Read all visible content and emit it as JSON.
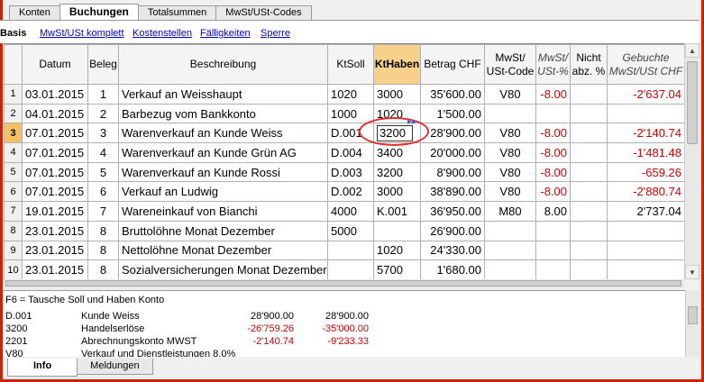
{
  "tabs": [
    "Konten",
    "Buchungen",
    "Totalsummen",
    "MwSt/USt-Codes"
  ],
  "active_tab": "Buchungen",
  "views": {
    "current": "Basis",
    "links": [
      "MwSt/USt komplett",
      "Kostenstellen",
      "Fälligkeiten",
      "Sperre"
    ]
  },
  "columns": {
    "datum": "Datum",
    "beleg": "Beleg",
    "beschreibung": "Beschreibung",
    "ktsoll": "KtSoll",
    "kthaben": "KtHaben",
    "betrag": "Betrag CHF",
    "mwst_code_1": "MwSt/",
    "mwst_code_2": "USt-Code",
    "mwst_pct_1": "MwSt/",
    "mwst_pct_2": "USt-%",
    "nicht_1": "Nicht",
    "nicht_2": "abz. %",
    "gebuchte_1": "Gebuchte",
    "gebuchte_2": "MwSt/USt CHF"
  },
  "rows": [
    {
      "n": "1",
      "datum": "03.01.2015",
      "beleg": "1",
      "beschreibung": "Verkauf an Weisshaupt",
      "ktsoll": "1020",
      "kthaben": "3000",
      "betrag": "35'600.00",
      "code": "V80",
      "pct": "-8.00",
      "nicht": "",
      "gebucht": "-2'637.04"
    },
    {
      "n": "2",
      "datum": "04.01.2015",
      "beleg": "2",
      "beschreibung": "Barbezug vom Bankkonto",
      "ktsoll": "1000",
      "kthaben": "1020",
      "betrag": "1'500.00",
      "code": "",
      "pct": "",
      "nicht": "",
      "gebucht": ""
    },
    {
      "n": "3",
      "datum": "07.01.2015",
      "beleg": "3",
      "beschreibung": "Warenverkauf an Kunde Weiss",
      "ktsoll": "D.001",
      "kthaben": "3200",
      "betrag": "28'900.00",
      "code": "V80",
      "pct": "-8.00",
      "nicht": "",
      "gebucht": "-2'140.74"
    },
    {
      "n": "4",
      "datum": "07.01.2015",
      "beleg": "4",
      "beschreibung": "Warenverkauf an Kunde Grün AG",
      "ktsoll": "D.004",
      "kthaben": "3400",
      "betrag": "20'000.00",
      "code": "V80",
      "pct": "-8.00",
      "nicht": "",
      "gebucht": "-1'481.48"
    },
    {
      "n": "5",
      "datum": "07.01.2015",
      "beleg": "5",
      "beschreibung": "Warenverkauf an Kunde Rossi",
      "ktsoll": "D.003",
      "kthaben": "3200",
      "betrag": "8'900.00",
      "code": "V80",
      "pct": "-8.00",
      "nicht": "",
      "gebucht": "-659.26"
    },
    {
      "n": "6",
      "datum": "07.01.2015",
      "beleg": "6",
      "beschreibung": "Verkauf an Ludwig",
      "ktsoll": "D.002",
      "kthaben": "3000",
      "betrag": "38'890.00",
      "code": "V80",
      "pct": "-8.00",
      "nicht": "",
      "gebucht": "-2'880.74"
    },
    {
      "n": "7",
      "datum": "19.01.2015",
      "beleg": "7",
      "beschreibung": "Wareneinkauf von Bianchi",
      "ktsoll": "4000",
      "kthaben": "K.001",
      "betrag": "36'950.00",
      "code": "M80",
      "pct": "8.00",
      "nicht": "",
      "gebucht": "2'737.04"
    },
    {
      "n": "8",
      "datum": "23.01.2015",
      "beleg": "8",
      "beschreibung": "Bruttolöhne Monat Dezember",
      "ktsoll": "5000",
      "kthaben": "",
      "betrag": "26'900.00",
      "code": "",
      "pct": "",
      "nicht": "",
      "gebucht": ""
    },
    {
      "n": "9",
      "datum": "23.01.2015",
      "beleg": "8",
      "beschreibung": "Nettolöhne Monat Dezember",
      "ktsoll": "",
      "kthaben": "1020",
      "betrag": "24'330.00",
      "code": "",
      "pct": "",
      "nicht": "",
      "gebucht": ""
    },
    {
      "n": "10",
      "datum": "23.01.2015",
      "beleg": "8",
      "beschreibung": "Sozialversicherungen Monat Dezember",
      "ktsoll": "",
      "kthaben": "5700",
      "betrag": "1'680.00",
      "code": "",
      "pct": "",
      "nicht": "",
      "gebucht": ""
    }
  ],
  "info": {
    "head": "F6 = Tausche Soll und Haben Konto",
    "lines": [
      {
        "konto": "D.001",
        "text": "Kunde Weiss",
        "v1": "28'900.00",
        "v2": "28'900.00"
      },
      {
        "konto": "3200",
        "text": "Handelserlöse",
        "v1": "-26'759.26",
        "v2": "-35'000.00"
      },
      {
        "konto": "2201",
        "text": "Abrechnungskonto MWST",
        "v1": "-2'140.74",
        "v2": "-9'233.33"
      },
      {
        "konto": "V80",
        "text": "Verkauf und Dienstleistungen 8.0%",
        "v1": "",
        "v2": ""
      }
    ]
  },
  "bottom_tabs": [
    "Info",
    "Meldungen"
  ],
  "colors": {
    "highlight": "#f7d08a",
    "negative": "#cc0000",
    "frame": "#cc2200",
    "link": "#0000cc"
  }
}
